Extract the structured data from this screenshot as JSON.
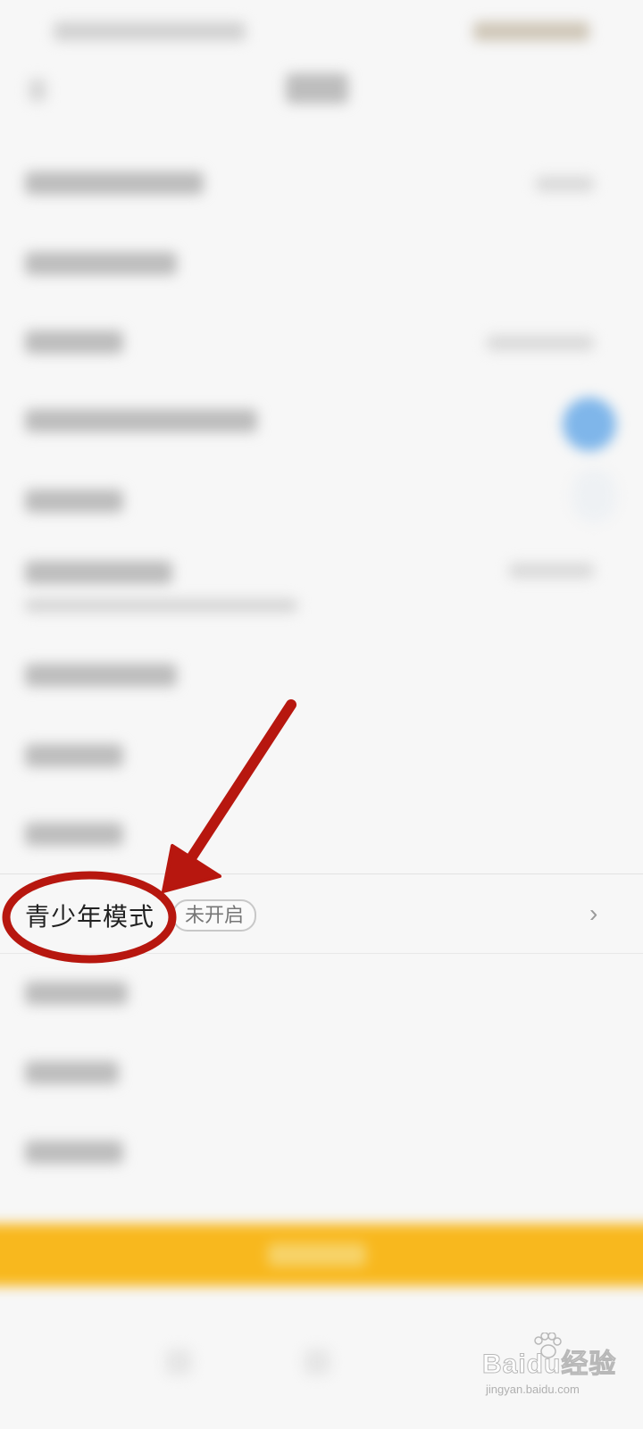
{
  "youth_mode_row": {
    "label": "青少年模式",
    "status_badge": "未开启",
    "chevron": "›"
  },
  "watermark": {
    "logo_text": "Baidu经验",
    "url_text": "jingyan.baidu.com"
  },
  "colors": {
    "annotation_red": "#b7170f",
    "primary_button": "#f8b81e",
    "toggle_blue": "#7fb6ea",
    "background": "#f7f7f7"
  },
  "icons": {
    "chevron": "chevron-right-icon",
    "annotation_arrow": "arrow-icon",
    "annotation_circle": "ellipse-highlight"
  }
}
